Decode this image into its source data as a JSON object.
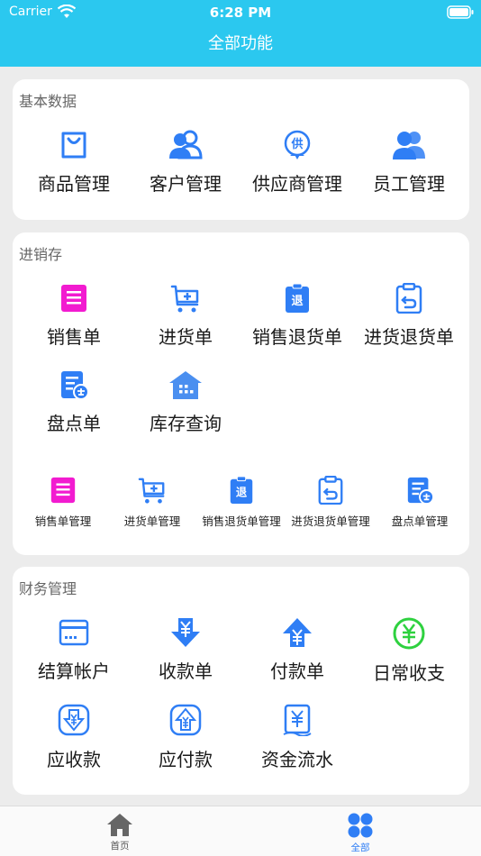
{
  "status_bar": {
    "carrier": "Carrier",
    "time": "6:28 PM"
  },
  "nav": {
    "title": "全部功能"
  },
  "sections": {
    "basic": {
      "title": "基本数据",
      "items": [
        "商品管理",
        "客户管理",
        "供应商管理",
        "员工管理"
      ],
      "supplier_icon_char": "供"
    },
    "inventory": {
      "title": "进销存",
      "items": [
        "销售单",
        "进货单",
        "销售退货单",
        "进货退货单",
        "盘点单",
        "库存查询"
      ],
      "management": [
        "销售单管理",
        "进货单管理",
        "销售退货单管理",
        "进货退货单管理",
        "盘点单管理"
      ],
      "return_icon_char": "退"
    },
    "finance": {
      "title": "财务管理",
      "items": [
        "结算帐户",
        "收款单",
        "付款单",
        "日常收支",
        "应收款",
        "应付款",
        "资金流水"
      ]
    }
  },
  "tabbar": {
    "home": "首页",
    "all": "全部"
  },
  "colors": {
    "primary": "#2bc8ef",
    "blue": "#2f7ef5",
    "magenta": "#f21bd0",
    "green": "#2ed13f",
    "tab_inactive": "#666666"
  }
}
